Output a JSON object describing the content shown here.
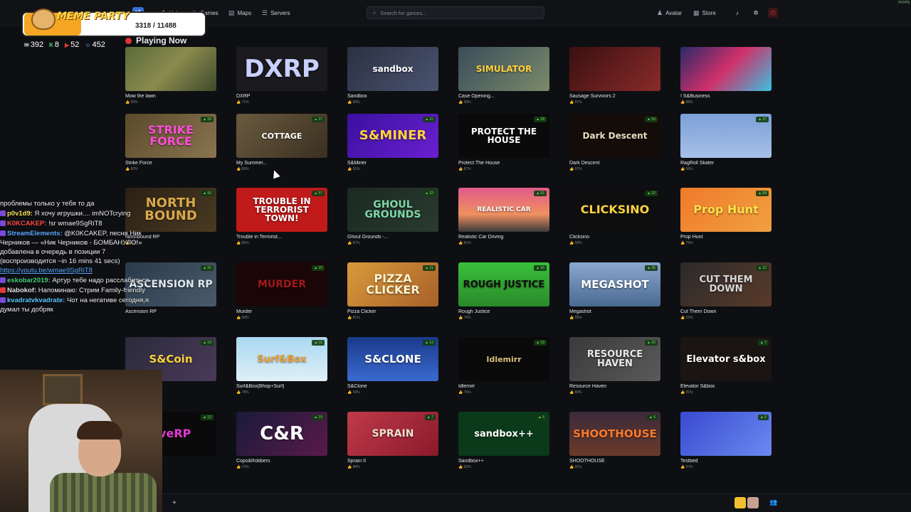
{
  "nav": {
    "logo": "s&",
    "items": [
      {
        "label": "Hub",
        "icon": "grid-icon"
      },
      {
        "label": "Games",
        "icon": "gamepad-icon"
      },
      {
        "label": "Maps",
        "icon": "map-icon"
      },
      {
        "label": "Servers",
        "icon": "list-icon"
      }
    ],
    "search_placeholder": "Search for games...",
    "avatar_label": "Avatar",
    "store_label": "Store",
    "fps": "74 FPS"
  },
  "section_title": "Playing Now",
  "games": [
    {
      "name": "Mow the lawn",
      "rating": "95%",
      "thumb_text": "",
      "bg": "linear-gradient(135deg,#5b6b3a,#8a8a4e 50%,#3f4a2a)",
      "color": "#fff",
      "size": 10
    },
    {
      "name": "DXRP",
      "rating": "71%",
      "thumb_text": "DXRP",
      "bg": "#1a1a1f",
      "color": "#c8d0ff",
      "size": 34
    },
    {
      "name": "Sandbox",
      "rating": "90%",
      "thumb_text": "sandbox",
      "bg": "linear-gradient(135deg,#2b3142,#4a5470)",
      "color": "#fff",
      "size": 12
    },
    {
      "name": "Case Opening...",
      "rating": "99%",
      "thumb_text": "SIMULATOR",
      "bg": "linear-gradient(135deg,#3a4c5a,#7a8a6a)",
      "color": "#ffd23f",
      "size": 12
    },
    {
      "name": "Sausage Survivors 2",
      "rating": "97%",
      "thumb_text": "",
      "bg": "linear-gradient(135deg,#3a1010,#8a2a2a)",
      "color": "#fff",
      "size": 10
    },
    {
      "name": "! S&Business",
      "rating": "88%",
      "thumb_text": "",
      "bg": "linear-gradient(135deg,#2a2a6a,#d0306a 50%,#3ac0e0)",
      "color": "#fff",
      "size": 10
    },
    {
      "name": "Strike Force",
      "rating": "82%",
      "thumb_text": "STRIKE FORCE",
      "bg": "linear-gradient(135deg,#5a4a2a,#8a7450)",
      "color": "#ff4fd8",
      "size": 16,
      "badge": "▲ 58"
    },
    {
      "name": "My Summer...",
      "rating": "85%",
      "thumb_text": "COTTAGE",
      "bg": "linear-gradient(135deg,#6a5a40,#3a3020)",
      "color": "#fff",
      "size": 11,
      "badge": "▲ 37"
    },
    {
      "name": "S&Miner",
      "rating": "91%",
      "thumb_text": "S&MINER",
      "bg": "linear-gradient(135deg,#3a10a0,#6a20d0)",
      "color": "#ffd23f",
      "size": 18,
      "badge": "▲ 31"
    },
    {
      "name": "Protect The House",
      "rating": "87%",
      "thumb_text": "PROTECT THE HOUSE",
      "bg": "#0a0a0a",
      "color": "#ffffff",
      "size": 12,
      "badge": "▲ 28"
    },
    {
      "name": "Dark Descent",
      "rating": "97%",
      "thumb_text": "Dark Descent",
      "bg": "#140c08",
      "color": "#e8dcc0",
      "size": 12,
      "badge": "▲ 56"
    },
    {
      "name": "RagRoll Skater",
      "rating": "99%",
      "thumb_text": "",
      "bg": "linear-gradient(180deg,#7aa0d8,#a8c0e8)",
      "color": "#fff",
      "size": 10,
      "badge": "▲ 37"
    },
    {
      "name": "Northbound RP",
      "rating": "93%",
      "thumb_text": "NORTH BOUND",
      "bg": "linear-gradient(135deg,#2a2014,#4a3a22)",
      "color": "#d8a84a",
      "size": 18,
      "badge": "▲ 56"
    },
    {
      "name": "Trouble in Terrorist...",
      "rating": "85%",
      "thumb_text": "TROUBLE IN TERRORIST TOWN!",
      "bg": "#c01a1a",
      "color": "#ffffff",
      "size": 12,
      "badge": "▲ 57"
    },
    {
      "name": "Ghoul Grounds -...",
      "rating": "87%",
      "thumb_text": "GHOUL GROUNDS",
      "bg": "linear-gradient(135deg,#1a2a22,#2a3a30)",
      "color": "#7fd8a8",
      "size": 14,
      "badge": "▲ 23"
    },
    {
      "name": "Realistic Car Driving",
      "rating": "81%",
      "thumb_text": "REALISTIC CAR",
      "bg": "linear-gradient(180deg,#e05a8a,#f09060 60%,#3a3a3a)",
      "color": "#fff",
      "size": 9,
      "badge": "▲ 61"
    },
    {
      "name": "Clicksino",
      "rating": "58%",
      "thumb_text": "CLICKSINO",
      "bg": "#0e0e0e",
      "color": "#ffd23f",
      "size": 16,
      "badge": "▲ 32"
    },
    {
      "name": "Prop Hunt",
      "rating": "79%",
      "thumb_text": "Prop Hunt",
      "bg": "linear-gradient(135deg,#f07a2a,#f0a040)",
      "color": "#ffe14a",
      "size": 16,
      "badge": "▲ 68"
    },
    {
      "name": "Ascension RP",
      "rating": "",
      "thumb_text": "ASCENSION RP",
      "bg": "linear-gradient(135deg,#2a3a4a,#4a5a6a)",
      "color": "#e0e8f0",
      "size": 14,
      "badge": "▲ 55"
    },
    {
      "name": "Murder",
      "rating": "58%",
      "thumb_text": "MURDER",
      "bg": "#1a0606",
      "color": "#a01818",
      "size": 14,
      "badge": "▲ 15"
    },
    {
      "name": "Pizza Clicker",
      "rating": "81%",
      "thumb_text": "PIZZA CLICKER",
      "bg": "linear-gradient(135deg,#d89a3a,#a8602a)",
      "color": "#fff4d0",
      "size": 16,
      "badge": "▲ 21"
    },
    {
      "name": "Rough Justice",
      "rating": "76%",
      "thumb_text": "ROUGH JUSTICE",
      "bg": "linear-gradient(180deg,#3ac03a,#2a8a2a)",
      "color": "#111",
      "size": 13,
      "badge": "▲ 36"
    },
    {
      "name": "Megashot",
      "rating": "95%",
      "thumb_text": "MEGASHOT",
      "bg": "linear-gradient(180deg,#8aa8d0,#4a6a90)",
      "color": "#fff",
      "size": 15,
      "badge": "▲ 35"
    },
    {
      "name": "Cut Them Down",
      "rating": "52%",
      "thumb_text": "CUT THEM DOWN",
      "bg": "linear-gradient(135deg,#2a2a2a,#5a3a2a)",
      "color": "#d8d8d8",
      "size": 13,
      "badge": "▲ 15"
    },
    {
      "name": "S&Coin",
      "rating": "",
      "thumb_text": "S&Coin",
      "bg": "linear-gradient(135deg,#2a2a3a,#4a3a5a)",
      "color": "#ffd23f",
      "size": 15,
      "badge": "▲ 19"
    },
    {
      "name": "Surf&Box(Bhop+Surf)",
      "rating": "78%",
      "thumb_text": "Surf&Box",
      "bg": "linear-gradient(180deg,#a8d8f0,#e0f0f8)",
      "color": "#f0a030",
      "size": 13,
      "badge": "▲ 11"
    },
    {
      "name": "S&Clone",
      "rating": "34%",
      "thumb_text": "S&CLONE",
      "bg": "linear-gradient(180deg,#1a3a8a,#3a6ad0)",
      "color": "#fff",
      "size": 15,
      "badge": "▲ 13"
    },
    {
      "name": "Idlemirr",
      "rating": "76%",
      "thumb_text": "Idlemirr",
      "bg": "#0a0a0a",
      "color": "#d8c080",
      "size": 11,
      "badge": "▲ 18"
    },
    {
      "name": "Resource Haven",
      "rating": "89%",
      "thumb_text": "RESOURCE HAVEN",
      "bg": "linear-gradient(135deg,#3a3a3a,#5a5a5a)",
      "color": "#e8e8e8",
      "size": 13,
      "badge": "▲ 20"
    },
    {
      "name": "Elevator S&box",
      "rating": "81%",
      "thumb_text": "Elevator s&box",
      "bg": "#1a1412",
      "color": "#ffffff",
      "size": 13,
      "badge": "▲ 7"
    },
    {
      "name": "",
      "rating": "",
      "thumb_text": "uveRP",
      "bg": "#0a0a0a",
      "color": "#e03ad0",
      "size": 16,
      "badge": "▲ 12"
    },
    {
      "name": "Cops&Robbers",
      "rating": "72%",
      "thumb_text": "C&R",
      "bg": "linear-gradient(135deg,#1a1a3a,#5a1a4a)",
      "color": "#ffffff",
      "size": 26,
      "badge": "▲ 19"
    },
    {
      "name": "Sprain II",
      "rating": "88%",
      "thumb_text": "SPRAIN",
      "bg": "linear-gradient(135deg,#c03a4a,#8a1a2a)",
      "color": "#f0e0d0",
      "size": 14,
      "badge": "▲ 7"
    },
    {
      "name": "Sandbox++",
      "rating": "92%",
      "thumb_text": "sandbox++",
      "bg": "#0a3a1a",
      "color": "#ffffff",
      "size": 13,
      "badge": "▲ 6"
    },
    {
      "name": "SHOOTHOUSE",
      "rating": "91%",
      "thumb_text": "SHOOTHOUSE",
      "bg": "linear-gradient(180deg,#3a2a3a,#6a3a2a)",
      "color": "#ff7a2a",
      "size": 15,
      "badge": "▲ 6"
    },
    {
      "name": "Testbed",
      "rating": "97%",
      "thumb_text": "",
      "bg": "linear-gradient(135deg,#3a4ad0,#6a8af0)",
      "color": "#fff",
      "size": 10,
      "badge": "▲ 6"
    }
  ],
  "overlay": {
    "title": "MEME PARTY",
    "counter": "3318 / 11488",
    "stats": [
      {
        "icon": "chat-icon",
        "value": "392"
      },
      {
        "icon": "kick-icon",
        "value": "8"
      },
      {
        "icon": "live-icon",
        "value": "52"
      },
      {
        "icon": "person-icon",
        "value": "452"
      }
    ]
  },
  "chat": [
    {
      "user": "",
      "text": "проблемы только у тебя то да",
      "color": "#ffffff"
    },
    {
      "user": "p0v1d9:",
      "text": " Я хочу игрушки.... imNOTcrying",
      "color": "#f7e35a"
    },
    {
      "user": "K0KCAKEP:",
      "text": " !sr wmae9SgRiT8",
      "color": "#ff4a4a"
    },
    {
      "user": "StreamElements:",
      "text": " @K0KCAKEP, песня Ник Черников — «Ник Черников - БОМБАНУЛО!» добавлена в очередь в позиции 7 (воспроизводится ~in 16 mins 41 secs) ",
      "color": "#5ca9ff",
      "link": "https://youtu.be/wmae9SgRiT8"
    },
    {
      "user": "eskobar2019:",
      "text": " Артур тебе надо расслабиться",
      "color": "#4ad07a"
    },
    {
      "user": "Nabokof:",
      "text": " Напоминаю: Стрим Family-friendly",
      "color": "#e0e0e0"
    },
    {
      "user": "kvadratvkvadrate:",
      "text": " Чот на негативе сегодня,я думал ты добряк",
      "color": "#5ac8ff"
    }
  ]
}
